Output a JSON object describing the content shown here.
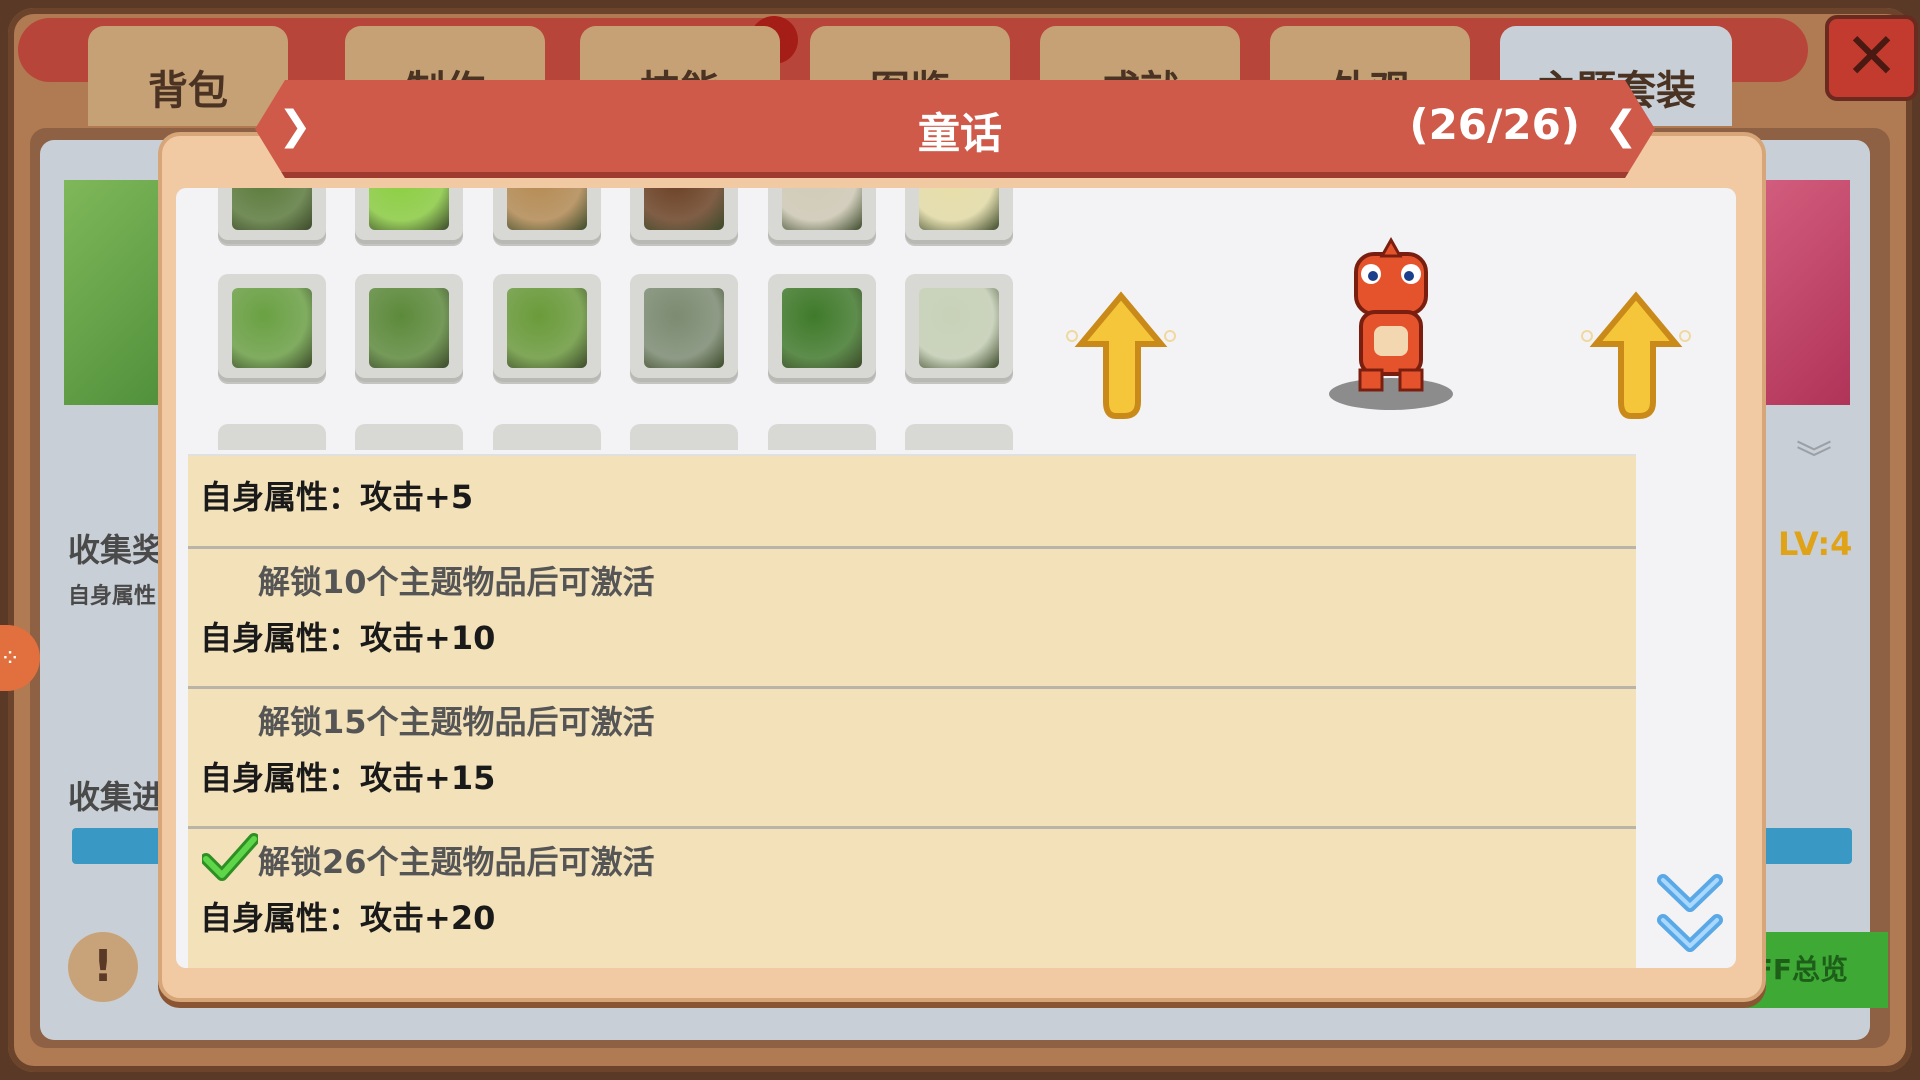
{
  "background": {
    "tabs": [
      "背包",
      "制作",
      "技能",
      "图鉴",
      "成就",
      "外观",
      "主题套装"
    ],
    "collect_reward_label": "收集奖",
    "self_attr_label": "自身属性",
    "collect_progress_label": "收集进",
    "level_label": "LV:4",
    "buff_button_label": "UFF总览",
    "close_label": "✕",
    "help_label": "!"
  },
  "popup": {
    "title": "童话",
    "count": "(26/26)",
    "prev_arrow": "❯",
    "next_arrow": "❮",
    "items": [
      {
        "name": "flower-bed-item",
        "color": "#5a7a3a"
      },
      {
        "name": "grass-bush-item",
        "color": "#8bcf3f"
      },
      {
        "name": "cabinet-item",
        "color": "#b58a52"
      },
      {
        "name": "tree-trunk-item",
        "color": "#6a3f22"
      },
      {
        "name": "stone-tile-item",
        "color": "#d2ccb8"
      },
      {
        "name": "stall-item",
        "color": "#e8dfa8"
      },
      {
        "name": "leafy-bench-item",
        "color": "#6aa143"
      },
      {
        "name": "leafy-arch-item",
        "color": "#5c8a3a"
      },
      {
        "name": "flower-planter-item",
        "color": "#6a9b3a"
      },
      {
        "name": "mossy-rock-item",
        "color": "#7c8b72"
      },
      {
        "name": "hedge-item",
        "color": "#3f7a2a"
      },
      {
        "name": "stone-floor-item",
        "color": "#c8d2b8"
      }
    ],
    "rows": [
      {
        "condition": "",
        "attribute": "自身属性：攻击+5",
        "done": false
      },
      {
        "condition": "解锁10个主题物品后可激活",
        "attribute": "自身属性：攻击+10",
        "done": false
      },
      {
        "condition": "解锁15个主题物品后可激活",
        "attribute": "自身属性：攻击+15",
        "done": false
      },
      {
        "condition": "解锁26个主题物品后可激活",
        "attribute": "自身属性：攻击+20",
        "done": true
      }
    ],
    "colors": {
      "banner": "#cf5a4a",
      "list_bg": "#f3e1ba",
      "check": "#3fbf2f",
      "arrow_yellow": "#f6c63a"
    }
  }
}
